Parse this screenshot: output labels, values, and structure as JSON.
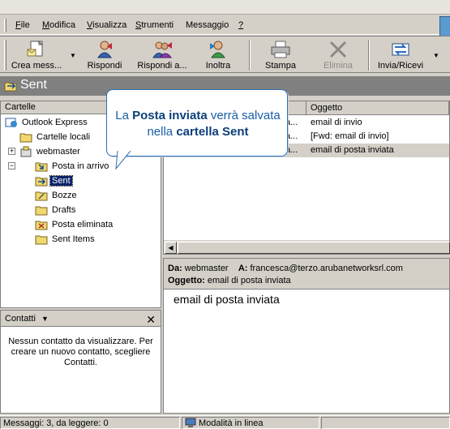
{
  "menu": {
    "items": [
      {
        "ul": "F",
        "rest": "ile"
      },
      {
        "ul": "M",
        "rest": "odifica"
      },
      {
        "ul": "V",
        "rest": "isualizza"
      },
      {
        "ul": "S",
        "rest": "trumenti"
      },
      {
        "ul": "",
        "rest": "Messaggio"
      },
      {
        "ul": "?",
        "rest": ""
      }
    ]
  },
  "toolbar": {
    "new_message": "Crea mess...",
    "reply": "Rispondi",
    "reply_all": "Rispondi a...",
    "forward": "Inoltra",
    "print": "Stampa",
    "delete": "Elimina",
    "send_receive": "Invia/Ricevi"
  },
  "titlebar": {
    "title": "Sent"
  },
  "folders": {
    "header": "Cartelle",
    "items": [
      {
        "label": "Outlook Express"
      },
      {
        "label": "Cartelle locali"
      },
      {
        "label": "webmaster"
      },
      {
        "label": "Posta in arrivo"
      },
      {
        "label": "Sent"
      },
      {
        "label": "Bozze"
      },
      {
        "label": "Drafts"
      },
      {
        "label": "Posta eliminata"
      },
      {
        "label": "Sent Items"
      }
    ]
  },
  "contacts": {
    "header": "Contatti",
    "message": "Nessun contatto da visualizzare. Per creare un nuovo contatto, scegliere Contatti."
  },
  "message_list": {
    "subject_header": "Oggetto",
    "rows": [
      {
        "from_trunc": "a...",
        "subject": "email di invio"
      },
      {
        "from_trunc": "a...",
        "subject": "[Fwd: email di invio]"
      },
      {
        "from_trunc": "a...",
        "subject": "email di posta inviata"
      }
    ]
  },
  "preview": {
    "from_label": "Da:",
    "from_value": "webmaster",
    "to_label": "A:",
    "to_value": "francesca@terzo.arubanetworksrl.com",
    "subject_label": "Oggetto:",
    "subject_value": "email di posta inviata",
    "body": "email di posta inviata"
  },
  "status": {
    "messages": "Messaggi: 3, da leggere: 0",
    "mode": "Modalità in linea"
  },
  "callout": {
    "part1": "La ",
    "bold1": "Posta inviata",
    "part2": " verrà salvata nella ",
    "bold2": "cartella Sent"
  }
}
